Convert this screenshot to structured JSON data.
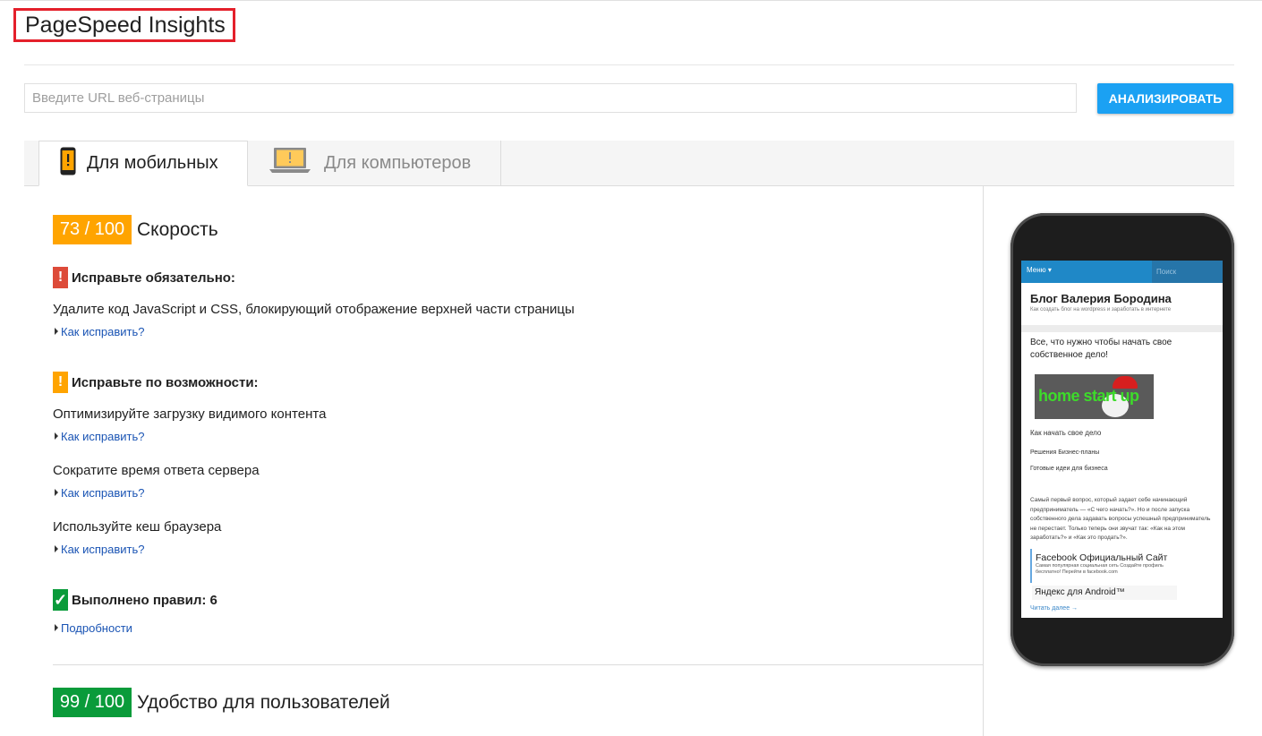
{
  "app": {
    "title": "PageSpeed Insights"
  },
  "search": {
    "placeholder": "Введите URL веб-страницы",
    "value": "",
    "button_label": "АНАЛИЗИРОВАТЬ"
  },
  "tabs": [
    {
      "label": "Для мобильных",
      "icon": "mobile-phone-icon",
      "active": true
    },
    {
      "label": "Для компьютеров",
      "icon": "laptop-icon",
      "active": false
    }
  ],
  "speed": {
    "score": "73 / 100",
    "label": "Скорость",
    "score_color": "#ffa400",
    "must_fix": {
      "badge": "!",
      "title": "Исправьте обязательно:",
      "rules": [
        {
          "text": "Удалите код JavaScript и CSS, блокирующий отображение верхней части страницы",
          "link": "Как исправить?"
        }
      ]
    },
    "should_fix": {
      "badge": "!",
      "title": "Исправьте по возможности:",
      "rules": [
        {
          "text": "Оптимизируйте загрузку видимого контента",
          "link": "Как исправить?"
        },
        {
          "text": "Сократите время ответа сервера",
          "link": "Как исправить?"
        },
        {
          "text": "Используйте кеш браузера",
          "link": "Как исправить?"
        }
      ]
    },
    "passed": {
      "badge": "✓",
      "title": "Выполнено правил: 6",
      "link": "Подробности"
    }
  },
  "usability": {
    "score": "99 / 100",
    "label": "Удобство для пользователей",
    "score_color": "#0a9b3a"
  },
  "preview": {
    "menu": "Меню ▾",
    "search": "Поиск",
    "blog_title": "Блог Валерия Бородина",
    "blog_subtitle": "Как создать блог на wordpress и заработать в интернете",
    "headline": "Все, что нужно чтобы начать свое собственное дело!",
    "logo_text": "home start up",
    "links": [
      "Как начать свое дело",
      "Решения Бизнес-планы",
      "Готовые идеи для бизнеса"
    ],
    "paragraph": "Самый первый вопрос, который задает себе начинающий предприниматель — «С чего начать?». Но и после запуска собственного дела задавать вопросы успешный предприниматель не перестает. Только теперь они звучат так: «Как на этом заработать?» и «Как это продать?».",
    "ad_title": "Facebook Официальный Сайт",
    "ad_desc": "Самая популярная социальная сеть Создайте профиль бесплатно! Перейти в facebook.com",
    "ad2_title": "Яндекс для Android™",
    "read_more": "Читать далее →"
  }
}
